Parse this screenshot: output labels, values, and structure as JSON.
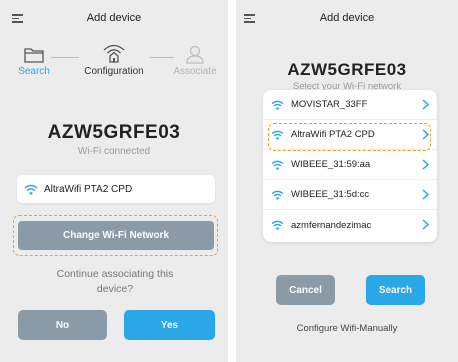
{
  "colors": {
    "accent": "#29a7e6",
    "secondary_button": "#8a9aa6",
    "dash": "#f0a030",
    "background": "#ececec"
  },
  "left": {
    "header_title": "Add device",
    "steps": [
      {
        "label": "Search",
        "icon": "folder-icon",
        "state": "done"
      },
      {
        "label": "Configuration",
        "icon": "router-wifi-icon",
        "state": "current"
      },
      {
        "label": "Associate",
        "icon": "user-icon",
        "state": "pending"
      }
    ],
    "device_name": "AZW5GRFE03",
    "device_status": "Wi-Fi connected",
    "connected_network": "AltraWifi PTA2 CPD",
    "change_button": "Change Wi-Fi Network",
    "continue_question": "Continue associating this device?",
    "no_button": "No",
    "yes_button": "Yes"
  },
  "right": {
    "header_title": "Add device",
    "device_name": "AZW5GRFE03",
    "prompt": "Select your Wi-Fi network",
    "networks": [
      {
        "name": "MOVISTAR_33FF",
        "selected": false
      },
      {
        "name": "AltraWifi PTA2 CPD",
        "selected": true
      },
      {
        "name": "WIBEEE_31:59:aa",
        "selected": false
      },
      {
        "name": "WIBEEE_31:5d:cc",
        "selected": false
      },
      {
        "name": "azmfernandezimac",
        "selected": false
      }
    ],
    "cancel_button": "Cancel",
    "search_button": "Search",
    "manual_link": "Configure Wifi-Manually"
  }
}
